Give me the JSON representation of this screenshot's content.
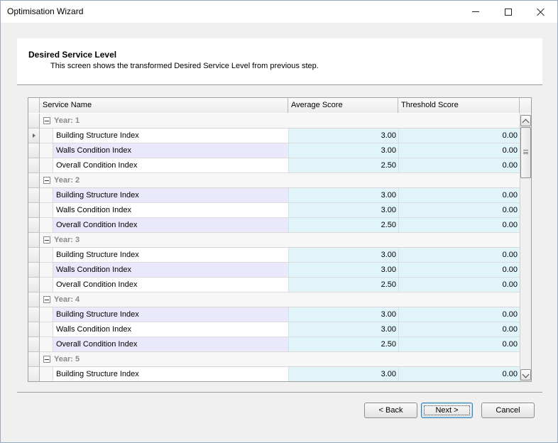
{
  "window": {
    "title": "Optimisation Wizard",
    "controls": {
      "minimize": "minimize",
      "maximize": "maximize",
      "close": "close"
    }
  },
  "header": {
    "title": "Desired Service Level",
    "subtitle": "This screen shows the transformed Desired Service Level from previous step."
  },
  "grid": {
    "columns": {
      "name": "Service Name",
      "average": "Average Score",
      "threshold": "Threshold Score"
    },
    "rows": [
      {
        "type": "group",
        "label": "Year: 1"
      },
      {
        "type": "data",
        "name": "Building Structure Index",
        "average": "3.00",
        "threshold": "0.00",
        "current": true,
        "alt": false
      },
      {
        "type": "data",
        "name": "Walls Condition Index",
        "average": "3.00",
        "threshold": "0.00",
        "alt": true
      },
      {
        "type": "data",
        "name": "Overall Condition Index",
        "average": "2.50",
        "threshold": "0.00",
        "alt": false
      },
      {
        "type": "group",
        "label": "Year: 2"
      },
      {
        "type": "data",
        "name": "Building Structure Index",
        "average": "3.00",
        "threshold": "0.00",
        "alt": true
      },
      {
        "type": "data",
        "name": "Walls Condition Index",
        "average": "3.00",
        "threshold": "0.00",
        "alt": false
      },
      {
        "type": "data",
        "name": "Overall Condition Index",
        "average": "2.50",
        "threshold": "0.00",
        "alt": true
      },
      {
        "type": "group",
        "label": "Year: 3"
      },
      {
        "type": "data",
        "name": "Building Structure Index",
        "average": "3.00",
        "threshold": "0.00",
        "alt": false
      },
      {
        "type": "data",
        "name": "Walls Condition Index",
        "average": "3.00",
        "threshold": "0.00",
        "alt": true
      },
      {
        "type": "data",
        "name": "Overall Condition Index",
        "average": "2.50",
        "threshold": "0.00",
        "alt": false
      },
      {
        "type": "group",
        "label": "Year: 4"
      },
      {
        "type": "data",
        "name": "Building Structure Index",
        "average": "3.00",
        "threshold": "0.00",
        "alt": true
      },
      {
        "type": "data",
        "name": "Walls Condition Index",
        "average": "3.00",
        "threshold": "0.00",
        "alt": false
      },
      {
        "type": "data",
        "name": "Overall Condition Index",
        "average": "2.50",
        "threshold": "0.00",
        "alt": true
      },
      {
        "type": "group",
        "label": "Year: 5"
      },
      {
        "type": "data",
        "name": "Building Structure Index",
        "average": "3.00",
        "threshold": "0.00",
        "alt": false
      }
    ]
  },
  "buttons": {
    "back": "< Back",
    "next": "Next >",
    "cancel": "Cancel"
  },
  "colors": {
    "value_cell_bg": "#e0f4fa",
    "alt_row_bg": "#e9e9fb",
    "group_text": "#8a8a8a"
  }
}
